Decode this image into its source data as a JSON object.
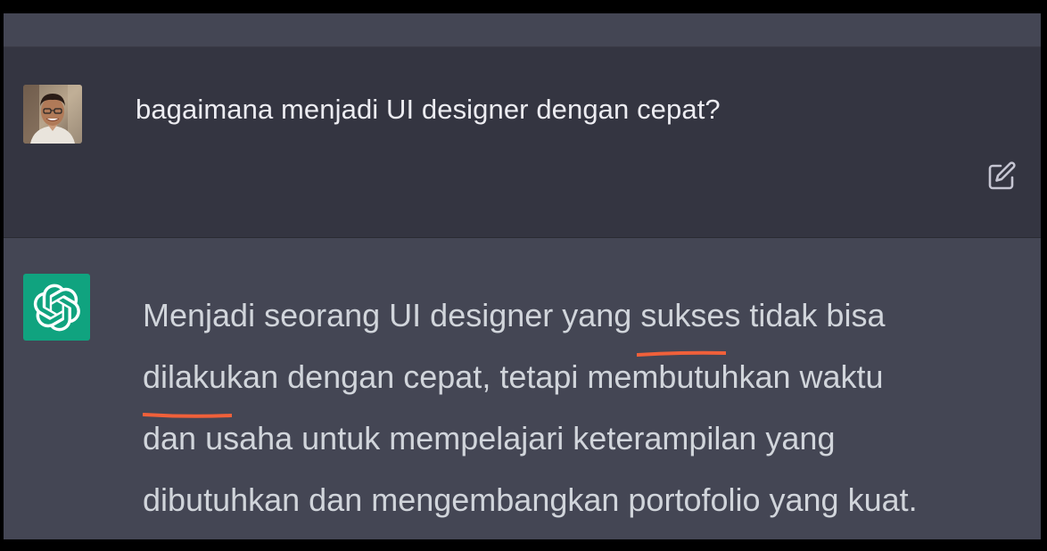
{
  "user_message": {
    "text": "bagaimana menjadi UI designer dengan cepat?"
  },
  "assistant_message": {
    "line1_before": "Menjadi seorang UI designer yang ",
    "line1_highlight": "sukses tidak bisa",
    "line2_highlight": "dilakukan dengan cepat",
    "line2_after": ", tetapi membutuhkan waktu",
    "line3": "dan usaha untuk mempelajari keterampilan yang",
    "line4": "dibutuhkan dan mengembangkan portofolio yang kuat."
  },
  "icons": {
    "user_avatar": "user-avatar",
    "edit": "edit-icon",
    "assistant_logo": "openai-logo-icon"
  },
  "colors": {
    "user_bg": "#343541",
    "assistant_bg": "#444654",
    "assistant_logo_bg": "#10a37f",
    "highlight_underline": "#f0603a"
  }
}
